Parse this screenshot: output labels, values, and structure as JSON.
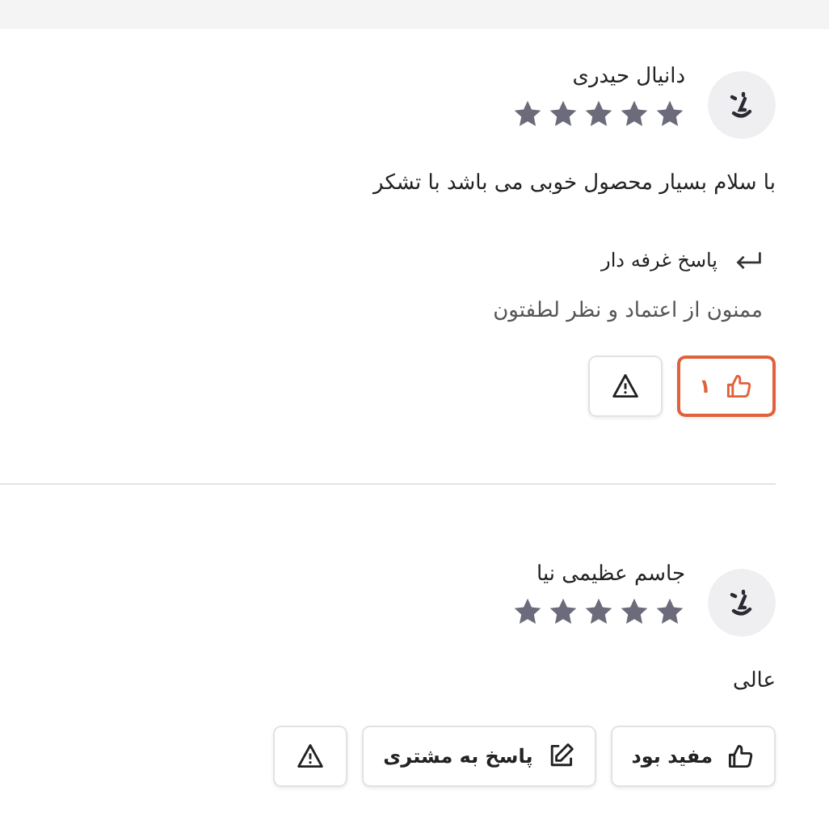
{
  "reviews": [
    {
      "name": "دانیال حیدری",
      "stars": 5,
      "comment": "با سلام بسیار محصول خوبی می باشد با تشکر",
      "reply": {
        "label": "پاسخ غرفه دار",
        "text": "ممنون از اعتماد و نظر لطفتون"
      },
      "like": {
        "count": "۱",
        "selected": true
      },
      "actions": [
        {
          "kind": "report"
        }
      ]
    },
    {
      "name": "جاسم عظیمی نیا",
      "stars": 5,
      "comment": "عالی",
      "like": {
        "label": "مفید بود",
        "selected": false
      },
      "actions": [
        {
          "kind": "respond",
          "label": "پاسخ به مشتری"
        },
        {
          "kind": "report"
        }
      ]
    }
  ]
}
